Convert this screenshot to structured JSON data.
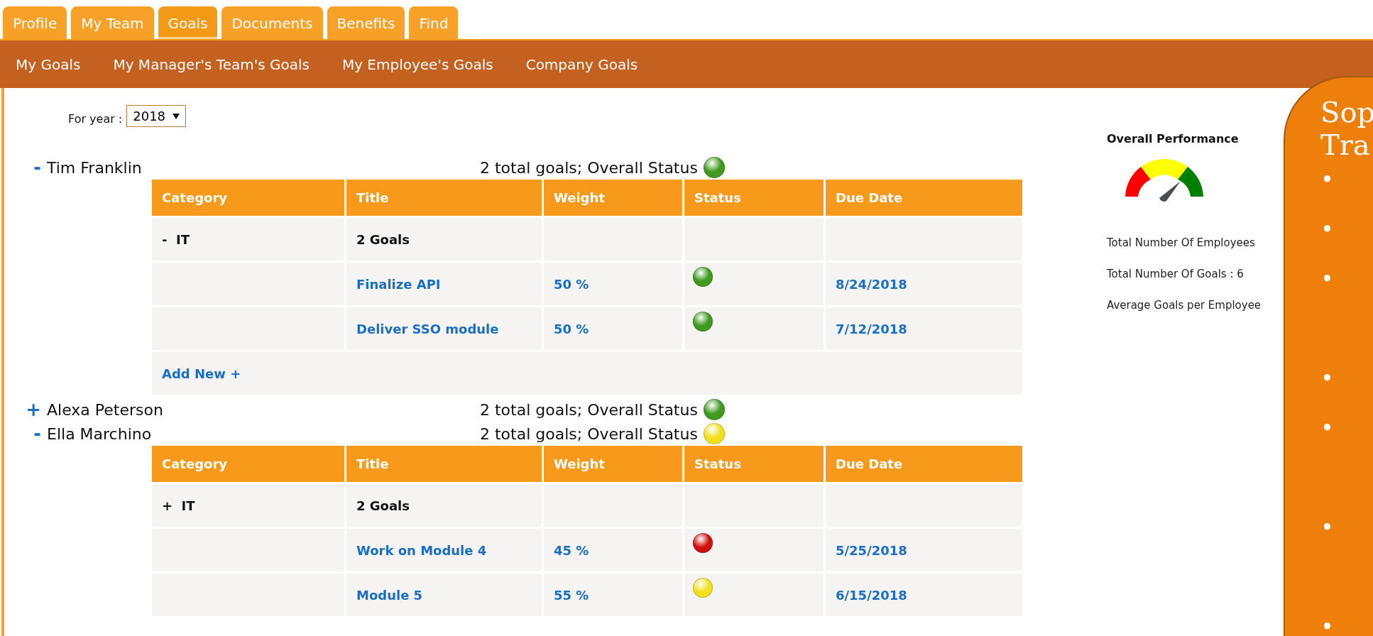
{
  "tabs": [
    {
      "label": "Profile",
      "selected": false
    },
    {
      "label": "My Team",
      "selected": false
    },
    {
      "label": "Goals",
      "selected": true
    },
    {
      "label": "Documents",
      "selected": false
    },
    {
      "label": "Benefits",
      "selected": false
    },
    {
      "label": "Find",
      "selected": false
    }
  ],
  "subnav": [
    "My Goals",
    "My Manager's Team's Goals",
    "My Employee's Goals",
    "Company Goals"
  ],
  "year_filter": {
    "label": "For year :",
    "value": "2018"
  },
  "employees": [
    {
      "toggle": "-",
      "name": "Tim Franklin",
      "summary": "2 total goals; Overall Status",
      "color": "#3f9a1f",
      "table": {
        "columns": [
          "Category",
          "Title",
          "Weight",
          "Status",
          "Due Date"
        ],
        "groups": [
          {
            "toggle": "-",
            "category": "IT",
            "count": "2 Goals",
            "rows": [
              {
                "title": "Finalize API",
                "weight": "50 %",
                "color": "#3f9a1f",
                "due": "8/24/2018"
              },
              {
                "title": "Deliver SSO module",
                "weight": "50 %",
                "color": "#3f9a1f",
                "due": "7/12/2018"
              }
            ]
          }
        ],
        "add_new": "Add New +"
      }
    },
    {
      "toggle": "+",
      "name": "Alexa Peterson",
      "summary": "2 total goals; Overall Status",
      "color": "#3f9a1f"
    },
    {
      "toggle": "-",
      "name": "Ella Marchino",
      "summary": "2 total goals; Overall Status",
      "color": "#f2e01c",
      "table": {
        "columns": [
          "Category",
          "Title",
          "Weight",
          "Status",
          "Due Date"
        ],
        "groups": [
          {
            "toggle": "+",
            "category": "IT",
            "count": "2 Goals",
            "rows": [
              {
                "title": "Work on Module 4",
                "weight": "45 %",
                "color": "#d01010",
                "due": "5/25/2018"
              },
              {
                "title": "Module 5",
                "weight": "55 %",
                "color": "#f2e01c",
                "due": "6/15/2018"
              }
            ]
          }
        ]
      }
    }
  ],
  "performance": {
    "title": "Overall Performance",
    "stats": [
      "Total Number Of Employees",
      "Total Number Of Goals : 6",
      "Average Goals per Employee"
    ]
  },
  "callout": {
    "heading": [
      "Sop",
      "Tra"
    ],
    "bullets": [
      "•",
      "•",
      "•",
      "•",
      "•",
      "•",
      "•"
    ]
  }
}
